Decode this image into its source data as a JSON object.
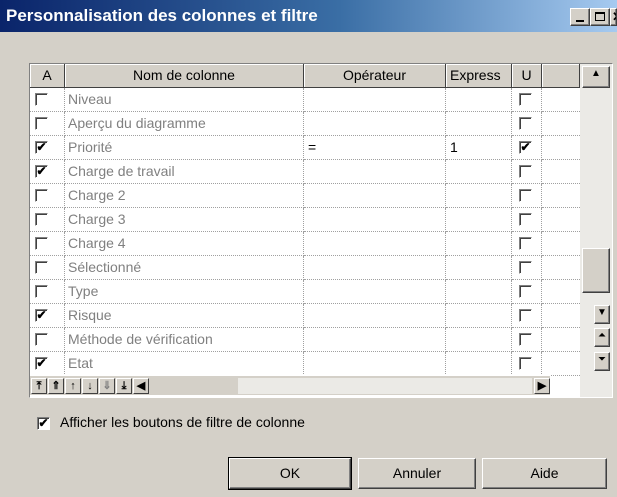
{
  "window": {
    "title": "Personnalisation des colonnes et filtre",
    "controls": [
      "minimize",
      "maximize",
      "close"
    ]
  },
  "grid": {
    "columns": [
      {
        "key": "a",
        "label": "A"
      },
      {
        "key": "name",
        "label": "Nom de colonne"
      },
      {
        "key": "operator",
        "label": "Opérateur"
      },
      {
        "key": "expression",
        "label": "Express"
      },
      {
        "key": "u",
        "label": "U"
      }
    ],
    "rows": [
      {
        "a": false,
        "name": "Niveau",
        "operator": "",
        "expression": "",
        "u": false
      },
      {
        "a": false,
        "name": "Aperçu du diagramme",
        "operator": "",
        "expression": "",
        "u": false
      },
      {
        "a": true,
        "name": "Priorité",
        "operator": "=",
        "expression": "1",
        "u": true
      },
      {
        "a": true,
        "name": "Charge de travail",
        "operator": "",
        "expression": "",
        "u": false
      },
      {
        "a": false,
        "name": "Charge 2",
        "operator": "",
        "expression": "",
        "u": false
      },
      {
        "a": false,
        "name": "Charge 3",
        "operator": "",
        "expression": "",
        "u": false
      },
      {
        "a": false,
        "name": "Charge 4",
        "operator": "",
        "expression": "",
        "u": false
      },
      {
        "a": false,
        "name": "Sélectionné",
        "operator": "",
        "expression": "",
        "u": false
      },
      {
        "a": false,
        "name": "Type",
        "operator": "",
        "expression": "",
        "u": false
      },
      {
        "a": true,
        "name": "Risque",
        "operator": "",
        "expression": "",
        "u": false
      },
      {
        "a": false,
        "name": "Méthode de vérification",
        "operator": "",
        "expression": "",
        "u": false
      },
      {
        "a": true,
        "name": "Etat",
        "operator": "",
        "expression": "",
        "u": false
      }
    ],
    "checkmark": "✔",
    "nav_buttons": [
      {
        "name": "move-top-icon",
        "glyph": "⤒",
        "disabled": false
      },
      {
        "name": "move-up-fast-icon",
        "glyph": "⇑",
        "disabled": false
      },
      {
        "name": "move-up-icon",
        "glyph": "↑",
        "disabled": false
      },
      {
        "name": "move-down-icon",
        "glyph": "↓",
        "disabled": false
      },
      {
        "name": "move-down-fast-icon",
        "glyph": "⇓",
        "disabled": true
      },
      {
        "name": "move-bottom-icon",
        "glyph": "⤓",
        "disabled": false
      },
      {
        "name": "scroll-left-icon",
        "glyph": "◀",
        "disabled": false
      }
    ]
  },
  "options": {
    "show_filter_buttons": {
      "checked": true,
      "label": "Afficher les boutons de filtre de colonne"
    }
  },
  "buttons": {
    "ok": "OK",
    "cancel": "Annuler",
    "help": "Aide"
  }
}
